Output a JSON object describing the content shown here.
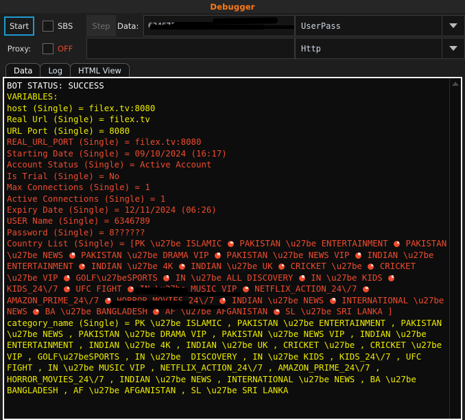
{
  "window": {
    "title": "Debugger",
    "title_color": "#ff7a18"
  },
  "toolbar": {
    "start_label": "Start",
    "sbs_label": "SBS",
    "step_label": "Step",
    "data_label": "Data:",
    "data_value": "63467??  ??????",
    "proxy_label": "Proxy:",
    "off_label": "OFF",
    "proxy_value": "",
    "proxy_placeholder": "",
    "auth_mode": "UserPass",
    "proxy_type": "Http",
    "auth_mode_options": [
      "UserPass"
    ],
    "proxy_type_options": [
      "Http"
    ],
    "sbs_checked": false,
    "proxy_checked": false,
    "accent_color": "#1d9bd1",
    "off_color": "#e8472c"
  },
  "tabs": [
    {
      "label": "Data",
      "active": true
    },
    {
      "label": "Log",
      "active": false
    },
    {
      "label": "HTML View",
      "active": false
    }
  ],
  "log": {
    "colors": {
      "white": "#ffffff",
      "yellow": "#ecec00",
      "red": "#ef4b2e"
    },
    "bullet_icon": "filled-circle-bullet",
    "lines": [
      {
        "color": "white",
        "text": "BOT STATUS: SUCCESS"
      },
      {
        "color": "yellow",
        "text": "VARIABLES:"
      },
      {
        "color": "yellow",
        "text": "host (Single) = filex.tv:8080"
      },
      {
        "color": "yellow",
        "text": "Real Url (Single) = filex.tv"
      },
      {
        "color": "yellow",
        "text": "URL Port (Single) = 8080"
      },
      {
        "color": "red",
        "text": "REAL_URL_PORT (Single) = filex.tv:8080"
      },
      {
        "color": "red",
        "text": "Starting Date (Single) = 09/10/2024 (16:17)"
      },
      {
        "color": "red",
        "text": "Account Status (Single) = Active Account"
      },
      {
        "color": "red",
        "text": "Is Trial (Single) = No"
      },
      {
        "color": "red",
        "text": "Max Connections (Single) = 1"
      },
      {
        "color": "red",
        "text": "Active Connections (Single) = 1"
      },
      {
        "color": "red",
        "text": "Expiry Date (Single) = 12/11/2024 (06:26)"
      },
      {
        "color": "red",
        "text": "USER Name (Single) = 6346789"
      },
      {
        "color": "red",
        "text": "Password (Single) = 8??????"
      },
      {
        "color": "red",
        "text": "Country List (Single) = [PK \\u27be ISLAMIC @ PAKISTAN \\u27be ENTERTAINMENT @ PAKISTAN \\u27be NEWS @ PAKISTAN \\u27be DRAMA VIP @ PAKISTAN \\u27be NEWS VIP @ INDIAN \\u27be ENTERTAINMENT @ INDIAN \\u27be 4K @ INDIAN \\u27be UK @ CRICKET \\u27be @ CRICKET \\u27be VIP @ GOLF\\u27beSPORTS @ IN \\u27be ALL DISCOVERY @ IN \\u27be KIDS @ KIDS_24\\/7 @ UFC FIGHT @ IN \\u27be MUSIC VIP @ NETFLIX_ACTION_24\\/7 @ AMAZON_PRIME_24\\/7 @ HORROR_MOVIES_24\\/7 @ INDIAN \\u27be NEWS @ INTERNATIONAL \\u27be NEWS @ BA \\u27be BANGLADESH @ AF \\u27be AFGANISTAN @ SL \\u27be SRI LANKA ]"
      },
      {
        "color": "yellow",
        "text": "category_name (Single) = PK \\u27be ISLAMIC , PAKISTAN \\u27be ENTERTAINMENT , PAKISTAN \\u27be NEWS , PAKISTAN \\u27be DRAMA VIP , PAKISTAN \\u27be NEWS VIP , INDIAN \\u27be ENTERTAINMENT , INDIAN \\u27be 4K , INDIAN \\u27be UK , CRICKET \\u27be , CRICKET \\u27be VIP , GOLF\\u27beSPORTS , IN \\u27be  DISCOVERY , IN \\u27be KIDS , KIDS_24\\/7 , UFC FIGHT , IN \\u27be MUSIC VIP , NETFLIX_ACTION_24\\/7 , AMAZON_PRIME_24\\/7 , HORROR_MOVIES_24\\/7 , INDIAN \\u27be NEWS , INTERNATIONAL \\u27be NEWS , BA \\u27be BANGLADESH , AF \\u27be AFGANISTAN , SL \\u27be SRI LANKA"
      }
    ]
  },
  "scrollbar": {
    "up_arrow_icon": "caret-up-icon"
  }
}
